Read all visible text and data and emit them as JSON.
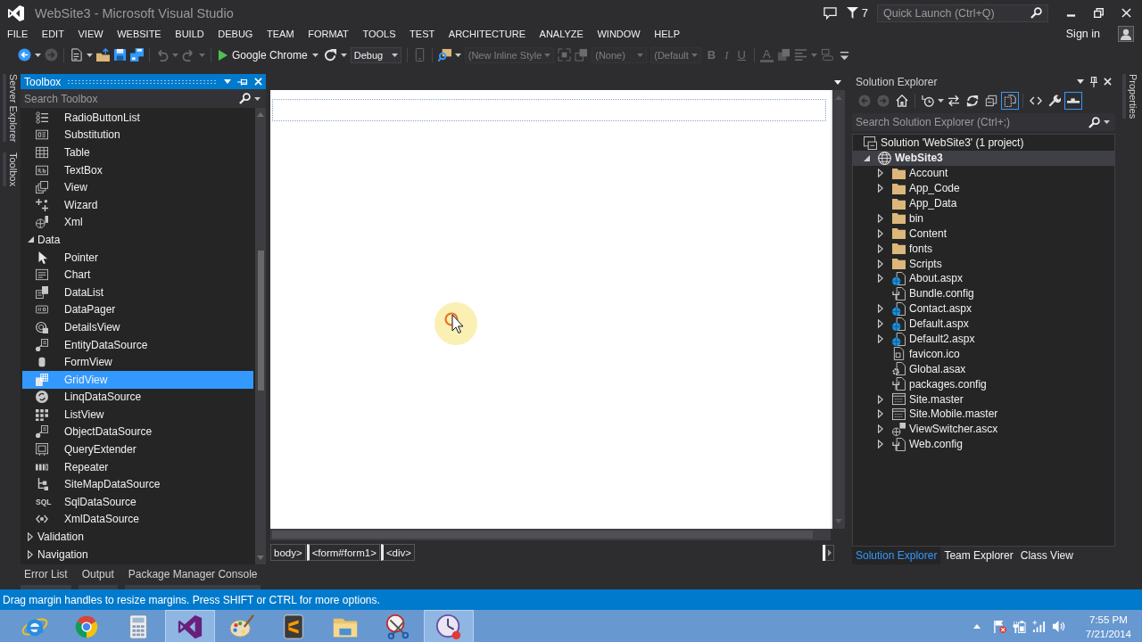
{
  "title_bar": {
    "title": "WebSite3 - Microsoft Visual Studio",
    "notification_count": "7",
    "quick_launch": {
      "placeholder": "Quick Launch (Ctrl+Q)"
    }
  },
  "menu_bar": {
    "items": [
      "FILE",
      "EDIT",
      "VIEW",
      "WEBSITE",
      "BUILD",
      "DEBUG",
      "TEAM",
      "FORMAT",
      "TOOLS",
      "TEST",
      "ARCHITECTURE",
      "ANALYZE",
      "WINDOW",
      "HELP"
    ],
    "sign_in": "Sign in"
  },
  "toolbar": [
    {
      "kind": "icon",
      "disabled": false,
      "dropdown": true
    },
    {
      "kind": "icon",
      "disabled": true,
      "dropdown": false
    },
    {
      "kind": "separator"
    },
    {
      "kind": "icon",
      "disabled": false,
      "dropdown": true
    },
    {
      "kind": "icon",
      "disabled": false,
      "dropdown": false
    },
    {
      "kind": "icon",
      "disabled": false,
      "dropdown": false
    },
    {
      "kind": "icon",
      "disabled": false,
      "dropdown": false
    },
    {
      "kind": "separator"
    },
    {
      "kind": "icon",
      "disabled": true,
      "dropdown": true
    },
    {
      "kind": "icon",
      "disabled": true,
      "dropdown": true
    },
    {
      "kind": "separator"
    },
    {
      "kind": "run",
      "label": "Google Chrome",
      "disabled": false
    },
    {
      "kind": "icon",
      "disabled": false,
      "dropdown": true
    },
    {
      "kind": "combo",
      "value": "Debug",
      "disabled": false
    },
    {
      "kind": "separator"
    },
    {
      "kind": "icon",
      "disabled": true,
      "dropdown": false
    },
    {
      "kind": "separator"
    },
    {
      "kind": "icon",
      "disabled": false,
      "dropdown": true
    },
    {
      "kind": "combo",
      "value": "(New Inline Style",
      "disabled": true
    },
    {
      "kind": "icon",
      "disabled": true,
      "dropdown": false
    },
    {
      "kind": "icon",
      "disabled": true,
      "dropdown": false
    },
    {
      "kind": "combo",
      "value": "(None)",
      "disabled": true
    },
    {
      "kind": "combo",
      "value": "(Default",
      "disabled": true
    },
    {
      "kind": "letter",
      "label": "B",
      "disabled": true
    },
    {
      "kind": "letter",
      "label": "I",
      "disabled": true
    },
    {
      "kind": "letter",
      "label": "U",
      "disabled": true
    },
    {
      "kind": "separator"
    },
    {
      "kind": "letter",
      "label": "A",
      "disabled": true
    },
    {
      "kind": "icon",
      "disabled": true,
      "dropdown": false
    },
    {
      "kind": "icon",
      "disabled": true,
      "dropdown": true
    },
    {
      "kind": "icon",
      "disabled": true,
      "dropdown": false
    },
    {
      "kind": "icon",
      "disabled": false,
      "dropdown": false
    }
  ],
  "left_tabs": [
    "Server Explorer",
    "Toolbox"
  ],
  "toolbox": {
    "title": "Toolbox",
    "search": {
      "placeholder": "Search Toolbox"
    },
    "items": [
      {
        "kind": "item",
        "label": "RadioButtonList",
        "selected": false
      },
      {
        "kind": "item",
        "label": "Substitution",
        "selected": false
      },
      {
        "kind": "item",
        "label": "Table",
        "selected": false
      },
      {
        "kind": "item",
        "label": "TextBox",
        "selected": false
      },
      {
        "kind": "item",
        "label": "View",
        "selected": false
      },
      {
        "kind": "item",
        "label": "Wizard",
        "selected": false
      },
      {
        "kind": "item",
        "label": "Xml",
        "selected": false
      },
      {
        "kind": "group",
        "label": "Data",
        "expanded": true,
        "selected": false,
        "children": [
          {
            "kind": "item",
            "label": "Pointer",
            "selected": false
          },
          {
            "kind": "item",
            "label": "Chart",
            "selected": false
          },
          {
            "kind": "item",
            "label": "DataList",
            "selected": false
          },
          {
            "kind": "item",
            "label": "DataPager",
            "selected": false
          },
          {
            "kind": "item",
            "label": "DetailsView",
            "selected": false
          },
          {
            "kind": "item",
            "label": "EntityDataSource",
            "selected": false
          },
          {
            "kind": "item",
            "label": "FormView",
            "selected": false
          },
          {
            "kind": "item",
            "label": "GridView",
            "selected": true
          },
          {
            "kind": "item",
            "label": "LinqDataSource",
            "selected": false
          },
          {
            "kind": "item",
            "label": "ListView",
            "selected": false
          },
          {
            "kind": "item",
            "label": "ObjectDataSource",
            "selected": false
          },
          {
            "kind": "item",
            "label": "QueryExtender",
            "selected": false
          },
          {
            "kind": "item",
            "label": "Repeater",
            "selected": false
          },
          {
            "kind": "item",
            "label": "SiteMapDataSource",
            "selected": false
          },
          {
            "kind": "item",
            "label": "SqlDataSource",
            "icon_label": "SQL",
            "selected": false
          },
          {
            "kind": "item",
            "label": "XmlDataSource",
            "selected": false
          }
        ]
      },
      {
        "kind": "group",
        "label": "Validation",
        "expanded": false,
        "selected": false
      },
      {
        "kind": "group",
        "label": "Navigation",
        "expanded": false,
        "selected": false
      }
    ]
  },
  "designer": {
    "tags": [
      "body>",
      "<form#form1>",
      "<div>"
    ]
  },
  "solution_explorer": {
    "title": "Solution Explorer",
    "toolbar": [
      {
        "kind": "icon",
        "disabled": true,
        "selected": false,
        "dropdown": false
      },
      {
        "kind": "icon",
        "disabled": true,
        "selected": false,
        "dropdown": false
      },
      {
        "kind": "icon",
        "disabled": false,
        "selected": false,
        "dropdown": false
      },
      {
        "kind": "separator"
      },
      {
        "kind": "icon",
        "disabled": false,
        "selected": false,
        "dropdown": true
      },
      {
        "kind": "icon",
        "disabled": false,
        "selected": false,
        "dropdown": false
      },
      {
        "kind": "icon",
        "disabled": false,
        "selected": false,
        "dropdown": false
      },
      {
        "kind": "icon",
        "disabled": false,
        "selected": false,
        "dropdown": false
      },
      {
        "kind": "icon",
        "disabled": false,
        "selected": true,
        "dropdown": false
      },
      {
        "kind": "separator"
      },
      {
        "kind": "icon",
        "disabled": false,
        "selected": false,
        "dropdown": false
      },
      {
        "kind": "icon",
        "disabled": false,
        "selected": false,
        "dropdown": false
      },
      {
        "kind": "icon",
        "disabled": false,
        "selected": true,
        "dropdown": false
      }
    ],
    "search": {
      "placeholder": "Search Solution Explorer (Ctrl+;)"
    },
    "tree": [
      {
        "kind": "solution",
        "label": "Solution 'WebSite3' (1 project)",
        "selected": false,
        "children": [
          {
            "kind": "project",
            "label": "WebSite3",
            "expanded": true,
            "selected": true,
            "children": [
              {
                "kind": "folder",
                "label": "Account",
                "expanded": false,
                "selected": false
              },
              {
                "kind": "folder",
                "label": "App_Code",
                "expanded": false,
                "selected": false
              },
              {
                "kind": "folder",
                "label": "App_Data",
                "selected": false
              },
              {
                "kind": "folder",
                "label": "bin",
                "expanded": false,
                "selected": false
              },
              {
                "kind": "folder",
                "label": "Content",
                "expanded": false,
                "selected": false
              },
              {
                "kind": "folder",
                "label": "fonts",
                "expanded": false,
                "selected": false
              },
              {
                "kind": "folder",
                "label": "Scripts",
                "expanded": false,
                "selected": false
              },
              {
                "kind": "page",
                "label": "About.aspx",
                "expanded": false,
                "selected": false
              },
              {
                "kind": "config",
                "label": "Bundle.config",
                "selected": false
              },
              {
                "kind": "page",
                "label": "Contact.aspx",
                "expanded": false,
                "selected": false
              },
              {
                "kind": "page",
                "label": "Default.aspx",
                "expanded": false,
                "selected": false
              },
              {
                "kind": "page",
                "label": "Default2.aspx",
                "expanded": false,
                "selected": false
              },
              {
                "kind": "image",
                "label": "favicon.ico",
                "selected": false
              },
              {
                "kind": "global",
                "label": "Global.asax",
                "selected": false
              },
              {
                "kind": "config",
                "label": "packages.config",
                "selected": false
              },
              {
                "kind": "master",
                "label": "Site.master",
                "expanded": false,
                "selected": false
              },
              {
                "kind": "master",
                "label": "Site.Mobile.master",
                "expanded": false,
                "selected": false
              },
              {
                "kind": "control",
                "label": "ViewSwitcher.ascx",
                "expanded": false,
                "selected": false
              },
              {
                "kind": "config",
                "label": "Web.config",
                "expanded": false,
                "selected": false
              }
            ]
          }
        ]
      }
    ],
    "tabs": [
      {
        "label": "Solution Explorer",
        "selected": true
      },
      {
        "label": "Team Explorer",
        "selected": false
      },
      {
        "label": "Class View",
        "selected": false
      }
    ]
  },
  "right_tabs": [
    "Properties"
  ],
  "bottom_tabs": [
    {
      "label": "Error List",
      "selected": false
    },
    {
      "label": "Output",
      "selected": false
    },
    {
      "label": "Package Manager Console",
      "selected": false
    }
  ],
  "status_bar": {
    "message": "Drag margin handles to resize margins. Press SHIFT or CTRL for more options."
  },
  "taskbar": {
    "apps": [
      {
        "selected": false
      },
      {
        "selected": false
      },
      {
        "selected": false
      },
      {
        "selected": true
      },
      {
        "selected": false
      },
      {
        "selected": false
      },
      {
        "selected": false
      },
      {
        "selected": false
      },
      {
        "selected": true
      }
    ],
    "time": "7:55 PM",
    "date": "7/21/2014"
  }
}
